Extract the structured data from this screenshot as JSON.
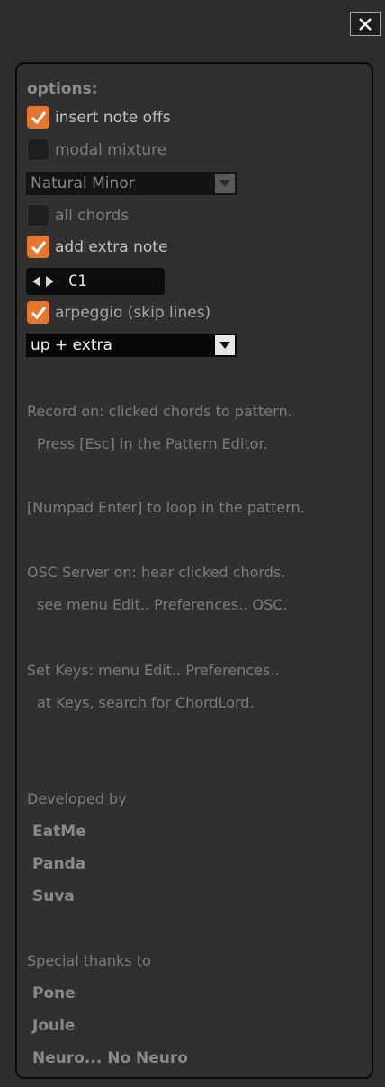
{
  "options": {
    "title": "options:",
    "insert_note_offs": {
      "label": "insert note offs",
      "checked": true
    },
    "modal_mixture": {
      "label": "modal mixture",
      "checked": false
    },
    "scale_select": {
      "value": "Natural Minor"
    },
    "all_chords": {
      "label": "all chords",
      "checked": false
    },
    "add_extra_note": {
      "label": "add extra note",
      "checked": true
    },
    "note_stepper": {
      "value": "C1"
    },
    "arpeggio": {
      "label": "arpeggio (skip lines)",
      "checked": true
    },
    "arp_mode_select": {
      "value": "up + extra"
    }
  },
  "info": {
    "record_line1": "Record on: clicked chords to pattern.",
    "record_line2": "Press [Esc] in the Pattern Editor.",
    "numpad_line": "[Numpad Enter] to loop in the pattern.",
    "osc_line1": "OSC Server on: hear clicked chords.",
    "osc_line2": "see menu Edit.. Preferences.. OSC.",
    "keys_line1": "Set Keys: menu Edit.. Preferences..",
    "keys_line2": "at Keys, search for ChordLord."
  },
  "credits": {
    "developed_by_label": "Developed by",
    "developers": [
      "EatMe",
      "Panda",
      "Suva"
    ],
    "thanks_label": "Special thanks to",
    "thanks": [
      "Pone",
      "Joule",
      "Neuro... No Neuro"
    ]
  },
  "icons": {
    "close": "close-icon",
    "check": "checkmark-icon",
    "dropdown": "chevron-down-icon",
    "stepper_left": "triangle-left-icon",
    "stepper_right": "triangle-right-icon"
  },
  "colors": {
    "accent": "#e4772f",
    "background": "#2c2c2c",
    "panel_border": "#0a0a0a"
  }
}
